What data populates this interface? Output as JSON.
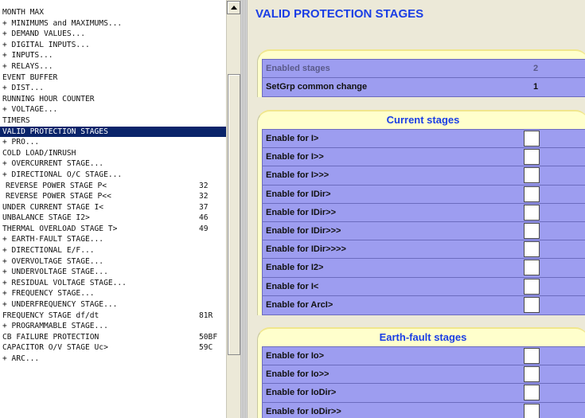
{
  "menu": {
    "items": [
      {
        "label": "MONTH MAX",
        "code": ""
      },
      {
        "label": "+ MINIMUMS and MAXIMUMS...",
        "code": ""
      },
      {
        "label": "+ DEMAND VALUES...",
        "code": ""
      },
      {
        "label": "+ DIGITAL INPUTS...",
        "code": ""
      },
      {
        "label": "+ INPUTS...",
        "code": ""
      },
      {
        "label": "+ RELAYS...",
        "code": ""
      },
      {
        "label": "EVENT BUFFER",
        "code": ""
      },
      {
        "label": "+ DIST...",
        "code": ""
      },
      {
        "label": "RUNNING HOUR COUNTER",
        "code": ""
      },
      {
        "label": "+ VOLTAGE...",
        "code": ""
      },
      {
        "label": "TIMERS",
        "code": ""
      },
      {
        "label": "VALID PROTECTION STAGES",
        "code": "",
        "selected": true
      },
      {
        "label": "+ PRO...",
        "code": ""
      },
      {
        "label": "COLD LOAD/INRUSH",
        "code": ""
      },
      {
        "label": "+ OVERCURRENT STAGE...",
        "code": ""
      },
      {
        "label": "+ DIRECTIONAL O/C STAGE...",
        "code": ""
      },
      {
        "label": "REVERSE POWER STAGE P<",
        "code": "32",
        "indent": true
      },
      {
        "label": "REVERSE POWER STAGE P<<",
        "code": "32",
        "indent": true
      },
      {
        "label": "UNDER CURRENT STAGE I<",
        "code": "37"
      },
      {
        "label": "UNBALANCE STAGE I2>",
        "code": "46"
      },
      {
        "label": "THERMAL OVERLOAD STAGE T>",
        "code": "49"
      },
      {
        "label": "+ EARTH-FAULT STAGE...",
        "code": ""
      },
      {
        "label": "+ DIRECTIONAL E/F...",
        "code": ""
      },
      {
        "label": "+ OVERVOLTAGE STAGE...",
        "code": ""
      },
      {
        "label": "+ UNDERVOLTAGE STAGE...",
        "code": ""
      },
      {
        "label": "+ RESIDUAL VOLTAGE STAGE...",
        "code": ""
      },
      {
        "label": "+ FREQUENCY STAGE...",
        "code": ""
      },
      {
        "label": "+ UNDERFREQUENCY STAGE...",
        "code": ""
      },
      {
        "label": "FREQUENCY STAGE df/dt",
        "code": "81R"
      },
      {
        "label": "+ PROGRAMMABLE STAGE...",
        "code": ""
      },
      {
        "label": "CB FAILURE PROTECTION",
        "code": "50BF"
      },
      {
        "label": "CAPACITOR O/V STAGE Uc>",
        "code": "59C"
      },
      {
        "label": "+ ARC...",
        "code": ""
      }
    ]
  },
  "page": {
    "title": "VALID PROTECTION STAGES"
  },
  "groups": [
    {
      "heading": "",
      "rows": [
        {
          "label": "Enabled stages",
          "value": "2",
          "dim": true
        },
        {
          "label": "SetGrp common change",
          "value": "1"
        }
      ]
    },
    {
      "heading": "Current stages",
      "rows": [
        {
          "label": "Enable for I>"
        },
        {
          "label": "Enable for I>>"
        },
        {
          "label": "Enable for I>>>"
        },
        {
          "label": "Enable for IDir>"
        },
        {
          "label": "Enable for IDir>>"
        },
        {
          "label": "Enable for IDir>>>"
        },
        {
          "label": "Enable for IDir>>>>"
        },
        {
          "label": "Enable for I2>"
        },
        {
          "label": "Enable for I<"
        },
        {
          "label": "Enable for ArcI>"
        }
      ]
    },
    {
      "heading": "Earth-fault stages",
      "rows": [
        {
          "label": "Enable for Io>"
        },
        {
          "label": "Enable for Io>>"
        },
        {
          "label": "Enable for IoDir>"
        },
        {
          "label": "Enable for IoDir>>"
        }
      ]
    }
  ],
  "colors": {
    "title": "#1a3ee5",
    "selection": "#0a246a",
    "row_bg": "#9d9df0",
    "panel_bg": "#ffffcc",
    "content_bg": "#ece9d8"
  }
}
